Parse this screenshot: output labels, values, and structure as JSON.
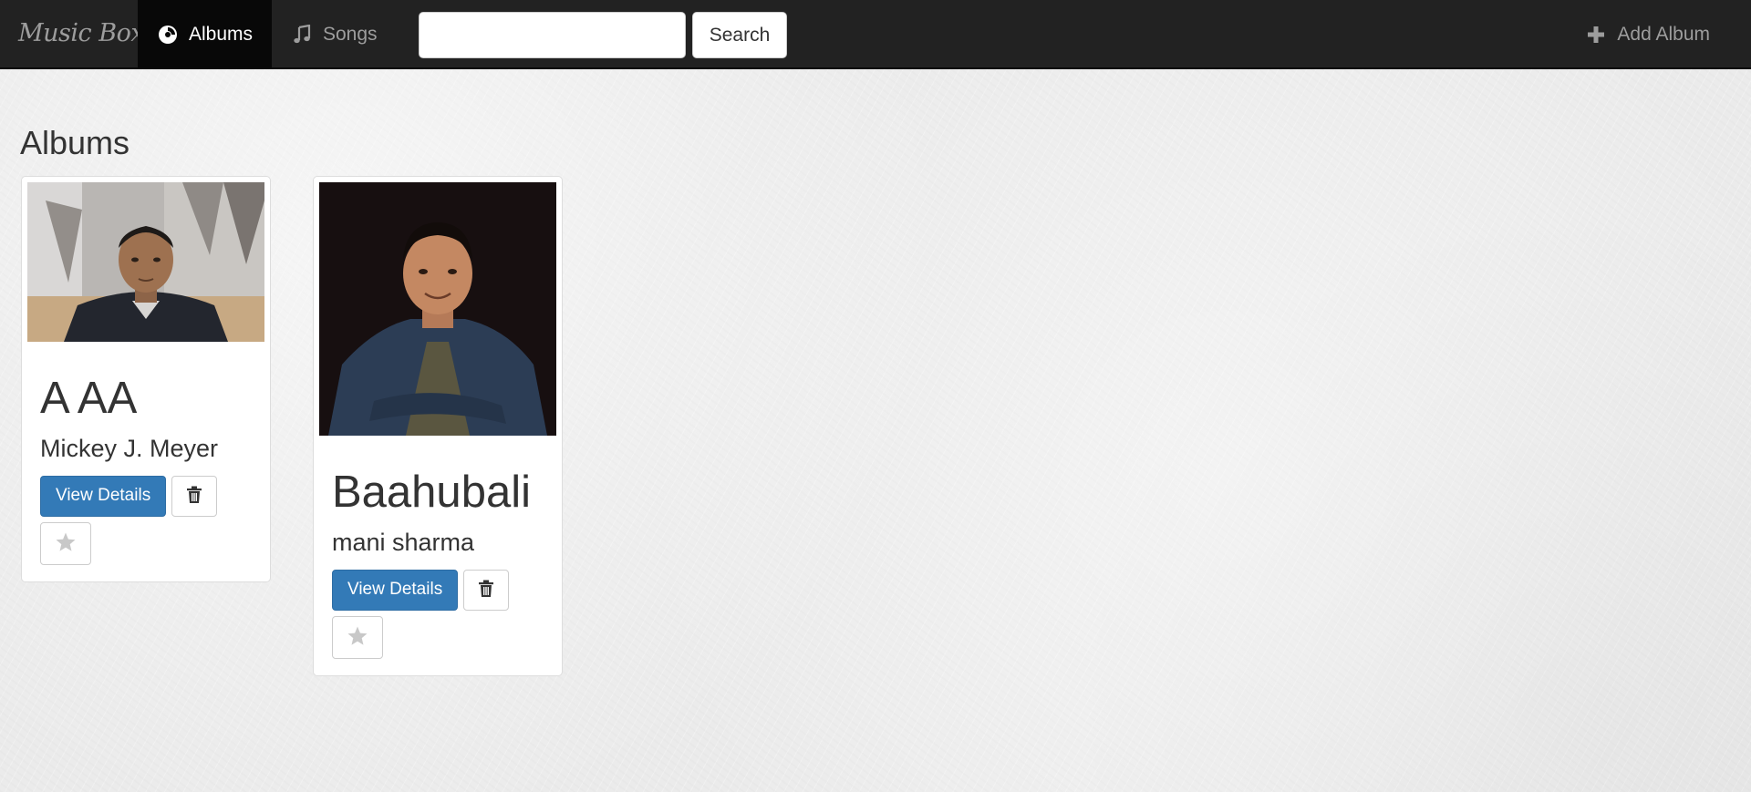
{
  "navbar": {
    "brand": "Music Box",
    "tabs": [
      {
        "label": "Albums",
        "icon": "disc-icon",
        "active": true
      },
      {
        "label": "Songs",
        "icon": "music-note-icon",
        "active": false
      }
    ],
    "search": {
      "value": "",
      "placeholder": ""
    },
    "search_button": "Search",
    "add_album": {
      "label": "Add Album",
      "icon": "plus-icon"
    }
  },
  "main": {
    "title": "Albums",
    "albums": [
      {
        "title": "A AA",
        "artist": "Mickey J. Meyer",
        "view_label": "View Details",
        "delete_icon": "trash-icon",
        "favorite_icon": "star-icon"
      },
      {
        "title": "Baahubali",
        "artist": "mani sharma",
        "view_label": "View Details",
        "delete_icon": "trash-icon",
        "favorite_icon": "star-icon"
      }
    ]
  },
  "colors": {
    "navbar": "#222222",
    "active_tab": "#080808",
    "primary": "#337ab7",
    "nav_text": "#9d9d9d"
  }
}
